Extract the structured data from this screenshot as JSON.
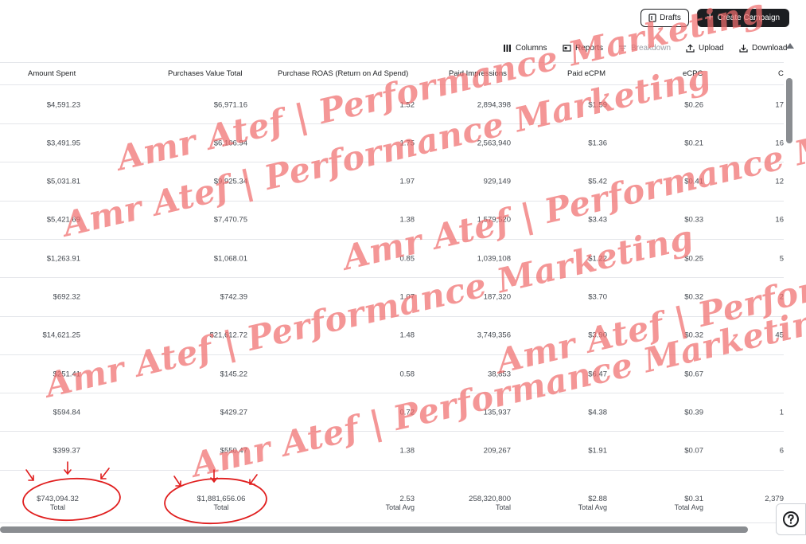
{
  "actions": {
    "drafts_label": "Drafts",
    "create_label": "Create Campaign"
  },
  "toolbar": {
    "columns": "Columns",
    "reports": "Reports",
    "breakdown": "Breakdown",
    "upload": "Upload",
    "download": "Download"
  },
  "headers": {
    "amount_spent": "Amount Spent",
    "purchases_value": "Purchases Value Total",
    "roas": "Purchase ROAS (Return on Ad Spend)",
    "paid_impressions": "Paid Impressions",
    "paid_ecpm": "Paid eCPM",
    "ecpc": "eCPC",
    "next": "C"
  },
  "rows": [
    {
      "amount": "$4,591.23",
      "purchases": "$6,971.16",
      "roas": "1.52",
      "impr": "2,894,398",
      "ecpm": "$1.59",
      "ecpc": "$0.26",
      "next": "17"
    },
    {
      "amount": "$3,491.95",
      "purchases": "$6,106.94",
      "roas": "1.75",
      "impr": "2,563,940",
      "ecpm": "$1.36",
      "ecpc": "$0.21",
      "next": "16"
    },
    {
      "amount": "$5,031.81",
      "purchases": "$9,925.34",
      "roas": "1.97",
      "impr": "929,149",
      "ecpm": "$5.42",
      "ecpc": "$0.41",
      "next": "12"
    },
    {
      "amount": "$5,421.69",
      "purchases": "$7,470.75",
      "roas": "1.38",
      "impr": "1,579,520",
      "ecpm": "$3.43",
      "ecpc": "$0.33",
      "next": "16"
    },
    {
      "amount": "$1,263.91",
      "purchases": "$1,068.01",
      "roas": "0.85",
      "impr": "1,039,108",
      "ecpm": "$1.22",
      "ecpc": "$0.25",
      "next": "5"
    },
    {
      "amount": "$692.32",
      "purchases": "$742.39",
      "roas": "1.07",
      "impr": "187,320",
      "ecpm": "$3.70",
      "ecpc": "$0.32",
      "next": "2"
    },
    {
      "amount": "$14,621.25",
      "purchases": "$21,612.72",
      "roas": "1.48",
      "impr": "3,749,356",
      "ecpm": "$3.90",
      "ecpc": "$0.32",
      "next": "45"
    },
    {
      "amount": "$251.41",
      "purchases": "$145.22",
      "roas": "0.58",
      "impr": "38,853",
      "ecpm": "$6.47",
      "ecpc": "$0.67",
      "next": ""
    },
    {
      "amount": "$594.84",
      "purchases": "$429.27",
      "roas": "0.72",
      "impr": "135,937",
      "ecpm": "$4.38",
      "ecpc": "$0.39",
      "next": "1"
    },
    {
      "amount": "$399.37",
      "purchases": "$550.47",
      "roas": "1.38",
      "impr": "209,267",
      "ecpm": "$1.91",
      "ecpc": "$0.07",
      "next": "6"
    }
  ],
  "totals": {
    "amount": "$743,094.32",
    "amount_sub": "Total",
    "purchases": "$1,881,656.06",
    "purchases_sub": "Total",
    "roas": "2.53",
    "roas_sub": "Total Avg",
    "impr": "258,320,800",
    "impr_sub": "Total",
    "ecpm": "$2.88",
    "ecpm_sub": "Total Avg",
    "ecpc": "$0.31",
    "ecpc_sub": "Total Avg",
    "next": "2,379"
  },
  "watermark": {
    "text": "Amr Atef | Performance Marketing"
  },
  "colors": {
    "accent_dark": "#1c1e21",
    "watermark": "#f06e6e",
    "annotation_red": "#e01e1e",
    "divider": "#e4e6ea"
  }
}
